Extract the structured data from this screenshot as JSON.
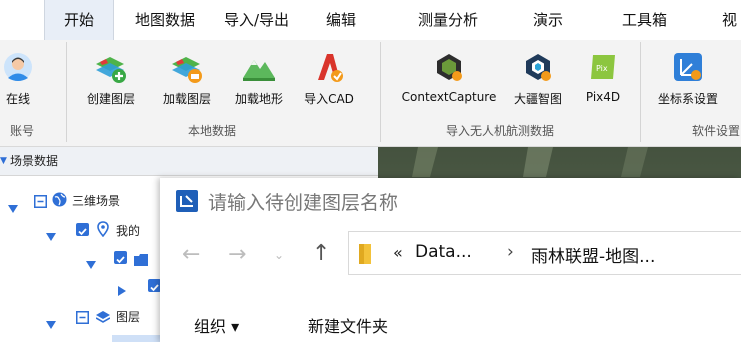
{
  "menu": {
    "tabs": [
      "开始",
      "地图数据",
      "导入/导出",
      "编辑",
      "测量分析",
      "演示",
      "工具箱",
      "视"
    ]
  },
  "ribbon": {
    "account": {
      "button": "在线",
      "group": "账号"
    },
    "local_data": {
      "buttons": [
        "创建图层",
        "加载图层",
        "加载地形",
        "导入CAD"
      ],
      "group": "本地数据"
    },
    "drone_data": {
      "buttons": [
        "ContextCapture",
        "大疆智图",
        "Pix4D"
      ],
      "group": "导入无人机航测数据"
    },
    "software": {
      "buttons": [
        "坐标系设置"
      ],
      "group": "软件设置"
    },
    "icons": [
      "user-icon",
      "create-layer-icon",
      "load-layer-icon",
      "load-terrain-icon",
      "import-cad-icon",
      "contextcapture-icon",
      "dji-terra-icon",
      "pix4d-icon",
      "coordinate-system-icon"
    ]
  },
  "tree": {
    "title": "场景数据",
    "nodes": [
      "三维场景",
      "我的",
      "图层"
    ]
  },
  "dialog": {
    "title": "请输入待创建图层名称",
    "path_prefix": "«",
    "path_segment_1": "Data...",
    "path_separator": "›",
    "path_segment_2": "雨林联盟-地图...",
    "organize_label": "组织 ▾",
    "new_folder_label": "新建文件夹"
  },
  "colors": {
    "accent": "#2f6fd6",
    "ribbon_bg": "#f3f3f3",
    "active_tab_bg": "#e8eef7"
  }
}
